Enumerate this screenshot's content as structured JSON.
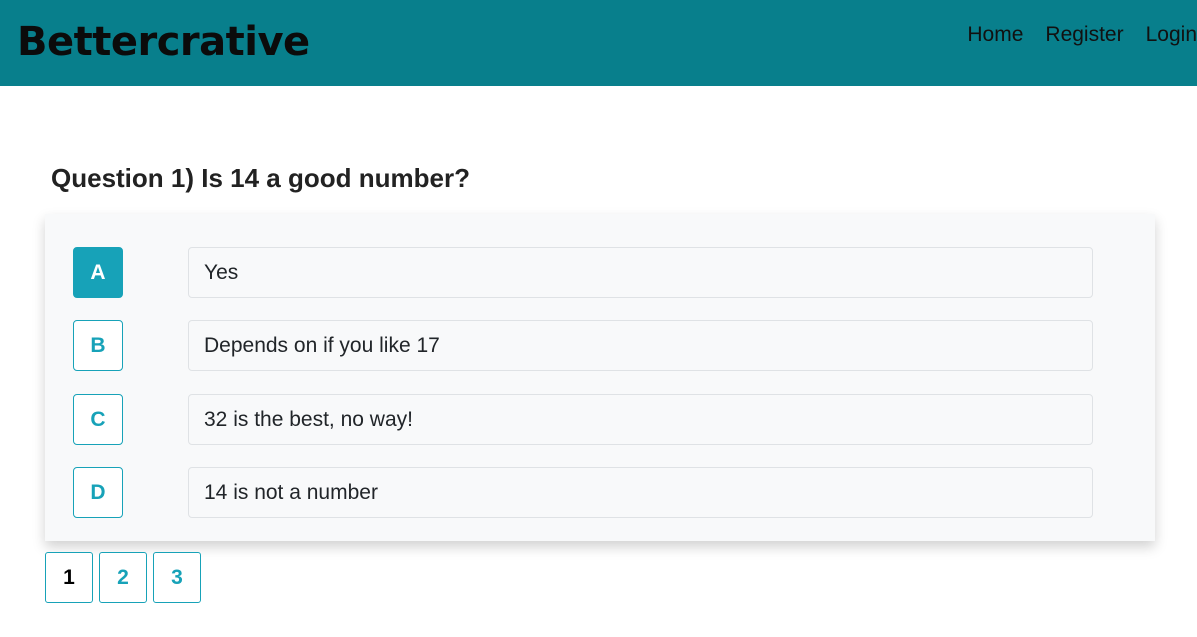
{
  "header": {
    "brand": "Bettercrative",
    "nav": [
      "Home",
      "Register",
      "Login"
    ],
    "background_color": "#087f8c"
  },
  "question": {
    "title": "Question 1) Is 14 a good number?",
    "answers": [
      {
        "letter": "A",
        "text": "Yes",
        "selected": true
      },
      {
        "letter": "B",
        "text": "Depends on if you like 17",
        "selected": false
      },
      {
        "letter": "C",
        "text": "32 is the best, no way!",
        "selected": false
      },
      {
        "letter": "D",
        "text": "14 is not a number",
        "selected": false
      }
    ],
    "accent_color": "#17a2b8"
  },
  "pagination": {
    "pages": [
      "1",
      "2",
      "3"
    ],
    "current": "1"
  }
}
